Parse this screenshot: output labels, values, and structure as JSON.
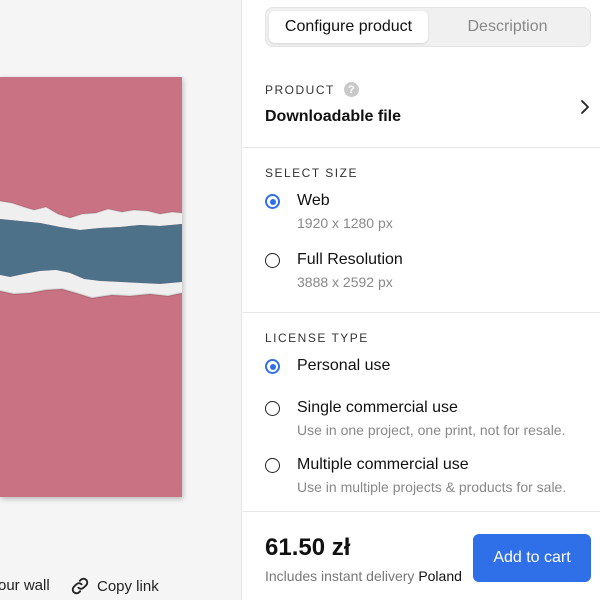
{
  "preview": {
    "wall_label": "our wall",
    "copy_link_label": "Copy link",
    "art_colors": {
      "background": "#c97283",
      "band": "#4c7188",
      "paper": "#efefef"
    }
  },
  "tabs": [
    {
      "label": "Configure product",
      "active": true
    },
    {
      "label": "Description",
      "active": false
    }
  ],
  "product": {
    "label": "PRODUCT",
    "help_icon": "?",
    "value": "Downloadable file"
  },
  "size": {
    "label": "SELECT SIZE",
    "options": [
      {
        "title": "Web",
        "subtitle": "1920 x 1280 px",
        "checked": true
      },
      {
        "title": "Full Resolution",
        "subtitle": "3888 x 2592 px",
        "checked": false
      }
    ]
  },
  "license": {
    "label": "LICENSE TYPE",
    "options": [
      {
        "title": "Personal use",
        "subtitle": "",
        "checked": true
      },
      {
        "title": "Single commercial use",
        "subtitle": "Use in one project, one print, not for resale.",
        "checked": false
      },
      {
        "title": "Multiple commercial use",
        "subtitle": "Use in multiple projects & products for sale.",
        "checked": false
      }
    ]
  },
  "footer": {
    "price": "61.50 zł",
    "delivery_text": "Includes instant delivery",
    "country": "Poland",
    "cart_button": "Add to cart"
  },
  "colors": {
    "accent": "#2f6fe8"
  }
}
